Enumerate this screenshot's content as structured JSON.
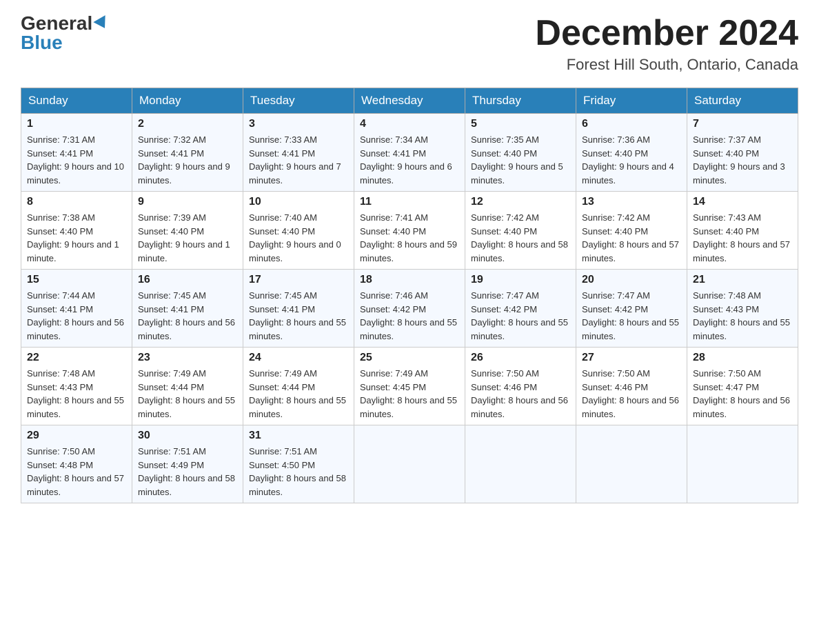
{
  "header": {
    "logo_general": "General",
    "logo_blue": "Blue",
    "month_title": "December 2024",
    "location": "Forest Hill South, Ontario, Canada"
  },
  "days_of_week": [
    "Sunday",
    "Monday",
    "Tuesday",
    "Wednesday",
    "Thursday",
    "Friday",
    "Saturday"
  ],
  "weeks": [
    [
      {
        "day": "1",
        "sunrise": "7:31 AM",
        "sunset": "4:41 PM",
        "daylight": "9 hours and 10 minutes."
      },
      {
        "day": "2",
        "sunrise": "7:32 AM",
        "sunset": "4:41 PM",
        "daylight": "9 hours and 9 minutes."
      },
      {
        "day": "3",
        "sunrise": "7:33 AM",
        "sunset": "4:41 PM",
        "daylight": "9 hours and 7 minutes."
      },
      {
        "day": "4",
        "sunrise": "7:34 AM",
        "sunset": "4:41 PM",
        "daylight": "9 hours and 6 minutes."
      },
      {
        "day": "5",
        "sunrise": "7:35 AM",
        "sunset": "4:40 PM",
        "daylight": "9 hours and 5 minutes."
      },
      {
        "day": "6",
        "sunrise": "7:36 AM",
        "sunset": "4:40 PM",
        "daylight": "9 hours and 4 minutes."
      },
      {
        "day": "7",
        "sunrise": "7:37 AM",
        "sunset": "4:40 PM",
        "daylight": "9 hours and 3 minutes."
      }
    ],
    [
      {
        "day": "8",
        "sunrise": "7:38 AM",
        "sunset": "4:40 PM",
        "daylight": "9 hours and 1 minute."
      },
      {
        "day": "9",
        "sunrise": "7:39 AM",
        "sunset": "4:40 PM",
        "daylight": "9 hours and 1 minute."
      },
      {
        "day": "10",
        "sunrise": "7:40 AM",
        "sunset": "4:40 PM",
        "daylight": "9 hours and 0 minutes."
      },
      {
        "day": "11",
        "sunrise": "7:41 AM",
        "sunset": "4:40 PM",
        "daylight": "8 hours and 59 minutes."
      },
      {
        "day": "12",
        "sunrise": "7:42 AM",
        "sunset": "4:40 PM",
        "daylight": "8 hours and 58 minutes."
      },
      {
        "day": "13",
        "sunrise": "7:42 AM",
        "sunset": "4:40 PM",
        "daylight": "8 hours and 57 minutes."
      },
      {
        "day": "14",
        "sunrise": "7:43 AM",
        "sunset": "4:40 PM",
        "daylight": "8 hours and 57 minutes."
      }
    ],
    [
      {
        "day": "15",
        "sunrise": "7:44 AM",
        "sunset": "4:41 PM",
        "daylight": "8 hours and 56 minutes."
      },
      {
        "day": "16",
        "sunrise": "7:45 AM",
        "sunset": "4:41 PM",
        "daylight": "8 hours and 56 minutes."
      },
      {
        "day": "17",
        "sunrise": "7:45 AM",
        "sunset": "4:41 PM",
        "daylight": "8 hours and 55 minutes."
      },
      {
        "day": "18",
        "sunrise": "7:46 AM",
        "sunset": "4:42 PM",
        "daylight": "8 hours and 55 minutes."
      },
      {
        "day": "19",
        "sunrise": "7:47 AM",
        "sunset": "4:42 PM",
        "daylight": "8 hours and 55 minutes."
      },
      {
        "day": "20",
        "sunrise": "7:47 AM",
        "sunset": "4:42 PM",
        "daylight": "8 hours and 55 minutes."
      },
      {
        "day": "21",
        "sunrise": "7:48 AM",
        "sunset": "4:43 PM",
        "daylight": "8 hours and 55 minutes."
      }
    ],
    [
      {
        "day": "22",
        "sunrise": "7:48 AM",
        "sunset": "4:43 PM",
        "daylight": "8 hours and 55 minutes."
      },
      {
        "day": "23",
        "sunrise": "7:49 AM",
        "sunset": "4:44 PM",
        "daylight": "8 hours and 55 minutes."
      },
      {
        "day": "24",
        "sunrise": "7:49 AM",
        "sunset": "4:44 PM",
        "daylight": "8 hours and 55 minutes."
      },
      {
        "day": "25",
        "sunrise": "7:49 AM",
        "sunset": "4:45 PM",
        "daylight": "8 hours and 55 minutes."
      },
      {
        "day": "26",
        "sunrise": "7:50 AM",
        "sunset": "4:46 PM",
        "daylight": "8 hours and 56 minutes."
      },
      {
        "day": "27",
        "sunrise": "7:50 AM",
        "sunset": "4:46 PM",
        "daylight": "8 hours and 56 minutes."
      },
      {
        "day": "28",
        "sunrise": "7:50 AM",
        "sunset": "4:47 PM",
        "daylight": "8 hours and 56 minutes."
      }
    ],
    [
      {
        "day": "29",
        "sunrise": "7:50 AM",
        "sunset": "4:48 PM",
        "daylight": "8 hours and 57 minutes."
      },
      {
        "day": "30",
        "sunrise": "7:51 AM",
        "sunset": "4:49 PM",
        "daylight": "8 hours and 58 minutes."
      },
      {
        "day": "31",
        "sunrise": "7:51 AM",
        "sunset": "4:50 PM",
        "daylight": "8 hours and 58 minutes."
      },
      null,
      null,
      null,
      null
    ]
  ],
  "labels": {
    "sunrise": "Sunrise:",
    "sunset": "Sunset:",
    "daylight": "Daylight:"
  }
}
